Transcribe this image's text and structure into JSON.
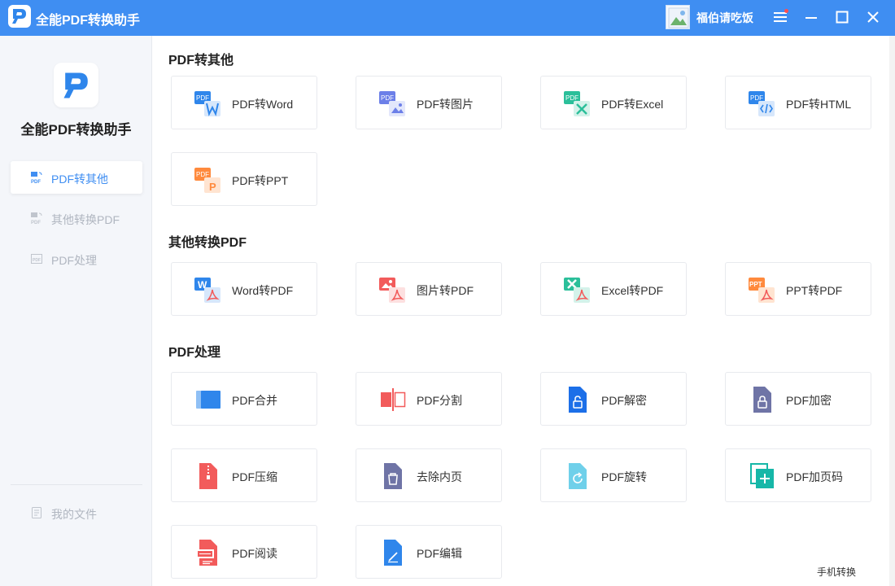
{
  "app": {
    "title": "全能PDF转换助手"
  },
  "user": {
    "name": "福伯请吃饭"
  },
  "titlebar_icons": [
    "menu-icon",
    "minimize-icon",
    "maximize-icon",
    "close-icon"
  ],
  "sidebar": {
    "title": "全能PDF转换助手",
    "items": [
      {
        "label": "PDF转其他",
        "active": true
      },
      {
        "label": "其他转换PDF",
        "active": false
      },
      {
        "label": "PDF处理",
        "active": false
      }
    ],
    "my_files": "我的文件"
  },
  "sections": {
    "pdf_to_other": {
      "title": "PDF转其他",
      "cards": [
        "PDF转Word",
        "PDF转图片",
        "PDF转Excel",
        "PDF转HTML",
        "PDF转PPT"
      ]
    },
    "other_to_pdf": {
      "title": "其他转换PDF",
      "cards": [
        "Word转PDF",
        "图片转PDF",
        "Excel转PDF",
        "PPT转PDF"
      ]
    },
    "pdf_process": {
      "title": "PDF处理",
      "cards": [
        "PDF合并",
        "PDF分割",
        "PDF解密",
        "PDF加密",
        "PDF压缩",
        "去除内页",
        "PDF旋转",
        "PDF加页码",
        "PDF阅读",
        "PDF编辑"
      ]
    }
  },
  "footer": {
    "mobile_convert": "手机转换"
  },
  "colors": {
    "accent": "#3f8ef2",
    "word": "#2f86eb",
    "image": "#6c7fe8",
    "excel": "#2bbf9a",
    "html": "#2f86eb",
    "ppt": "#ff8a3d",
    "pdf_red": "#f25b5b"
  }
}
